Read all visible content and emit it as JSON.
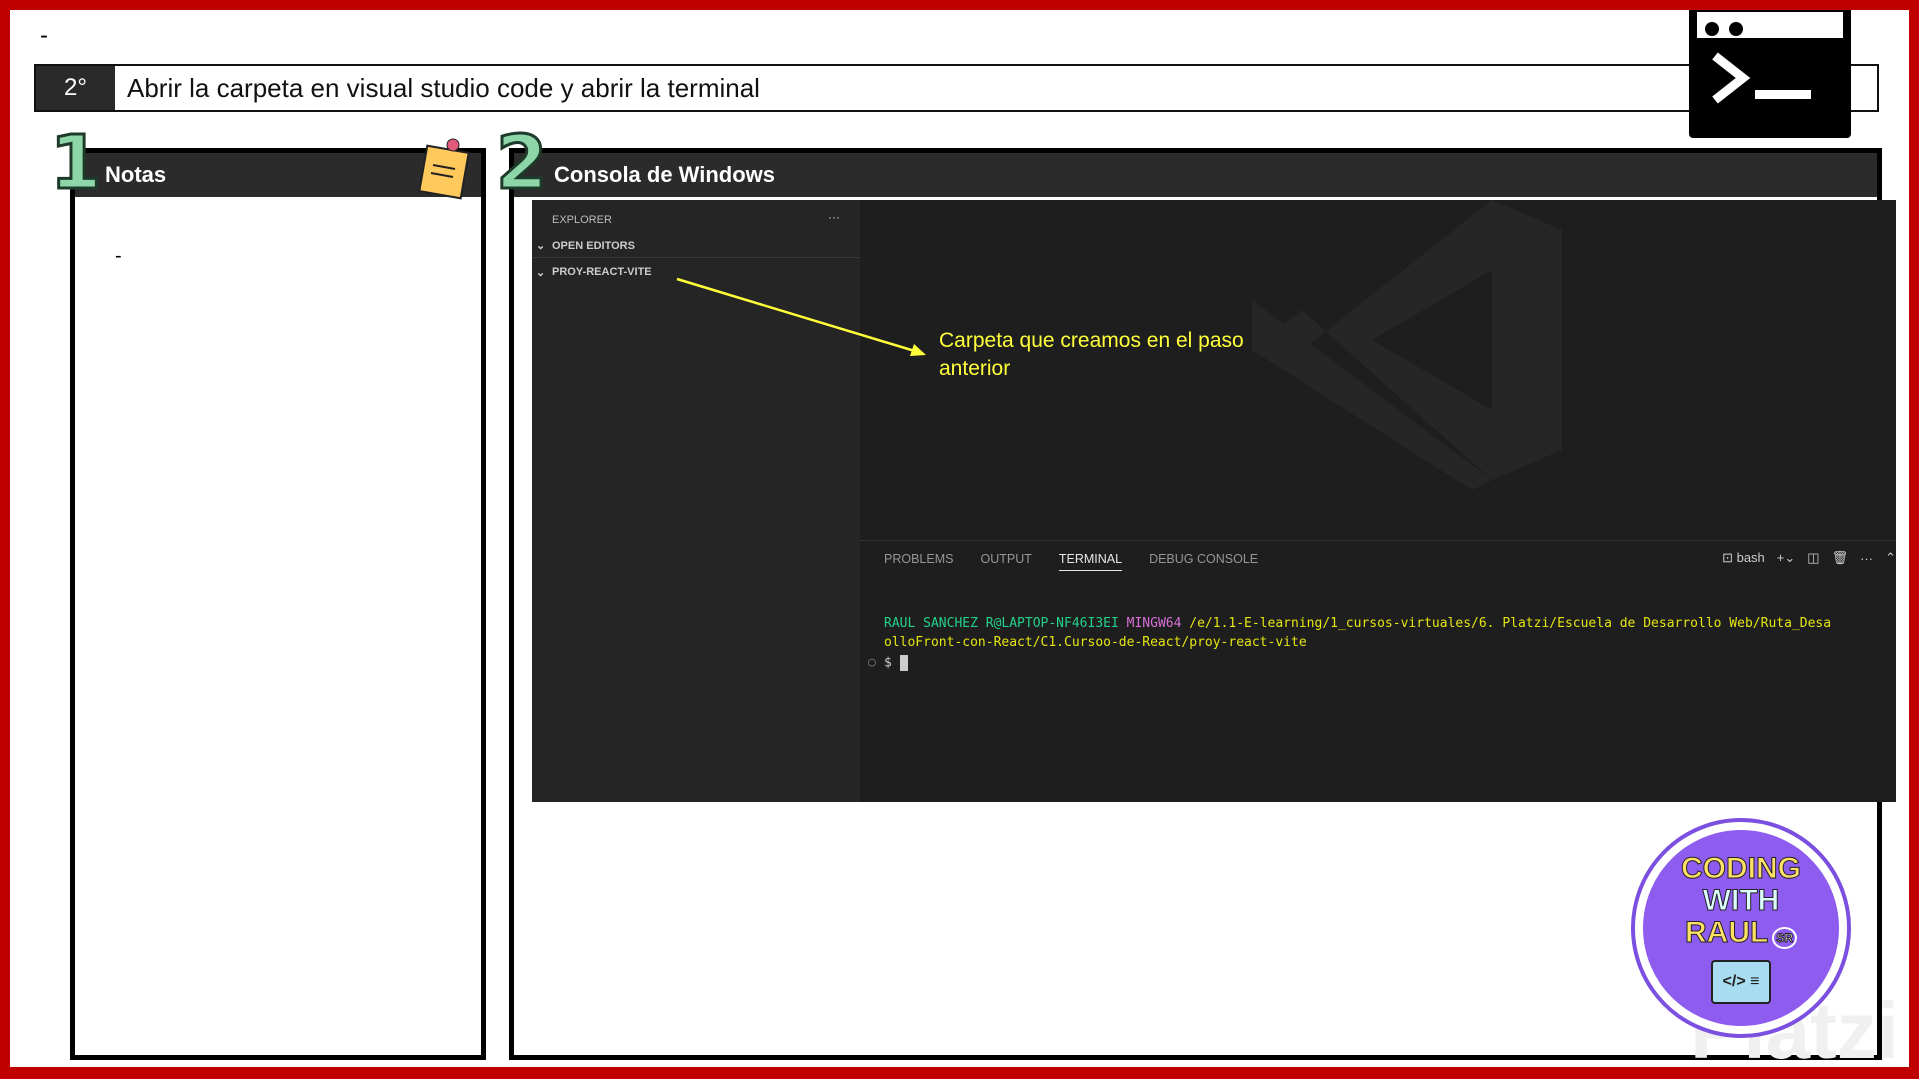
{
  "top_dash": "-",
  "step": {
    "number": "2°",
    "title": "Abrir la carpeta en visual studio code y abrir la terminal"
  },
  "notes": {
    "number": "1",
    "title": "Notas",
    "content": "-"
  },
  "console": {
    "number": "2",
    "title": "Consola de Windows"
  },
  "vscode": {
    "explorer": "EXPLORER",
    "more": "···",
    "open_editors": "OPEN EDITORS",
    "folder": "PROY-REACT-VITE",
    "tabs": [
      "PROBLEMS",
      "OUTPUT",
      "TERMINAL",
      "DEBUG CONSOLE"
    ],
    "shell": "bash",
    "terminal": {
      "user": "RAUL SANCHEZ R@LAPTOP-NF46I3EI",
      "env": "MINGW64",
      "path1": "/e/1.1-E-learning/1_cursos-virtuales/6. Platzi/Escuela de Desarrollo Web/Ruta_Desa",
      "path2": "olloFront-con-React/C1.Cursoo-de-React/proy-react-vite",
      "prompt": "$"
    }
  },
  "annotation": "Carpeta que creamos en el paso anterior",
  "logo": {
    "line1": "CODING",
    "line2": "WITH",
    "line3": "RAUL",
    "badge": "SR"
  },
  "watermark": "Platzi",
  "colors": {
    "border": "#c00000",
    "annotation": "#ffff3a",
    "user": "#23d18b",
    "env": "#d670d6",
    "path": "#e5e510"
  }
}
